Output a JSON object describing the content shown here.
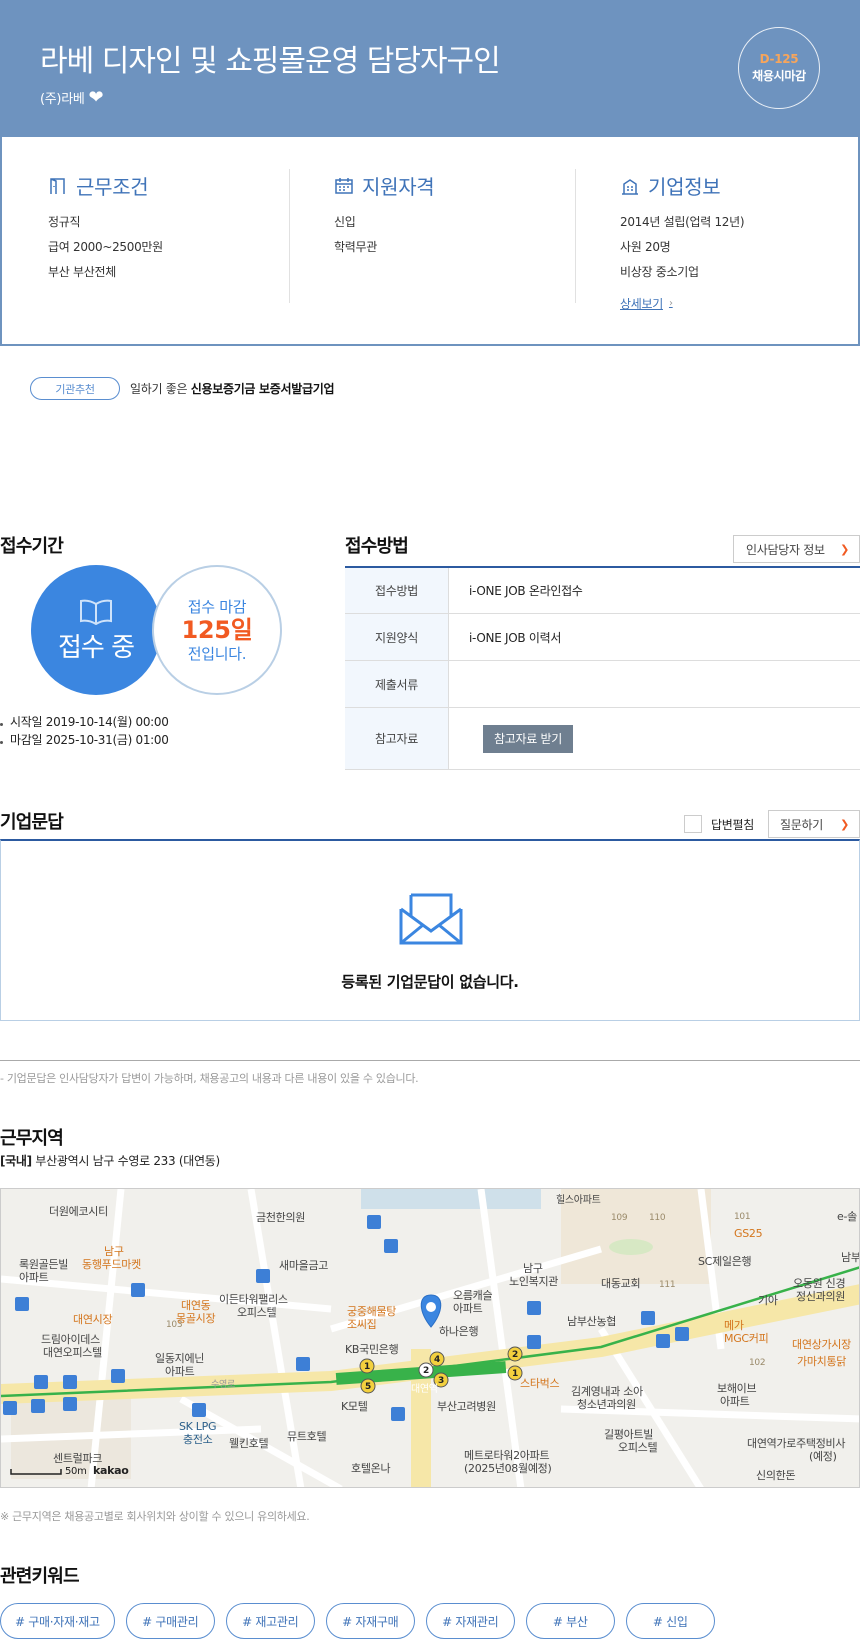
{
  "header": {
    "title": "라베 디자인 및 쇼핑몰운영 담당자구인",
    "company": "(주)라베",
    "dday": "D-125",
    "dday_label": "채용시마감"
  },
  "summary": {
    "work": {
      "title": "근무조건",
      "lines": [
        "정규직",
        "급여 2000~2500만원",
        "부산 부산전체"
      ]
    },
    "qual": {
      "title": "지원자격",
      "lines": [
        "신입",
        "학력무관"
      ]
    },
    "company": {
      "title": "기업정보",
      "lines": [
        "2014년 설립(업력 12년)",
        "사원 20명",
        "비상장 중소기업"
      ],
      "detail_link": "상세보기"
    }
  },
  "recommend": {
    "badge": "기관추천",
    "prefix": "일하기 좋은 ",
    "bold": "신용보증기금 보증서발급기업"
  },
  "period": {
    "title": "접수기간",
    "status": "접수 중",
    "remain_prefix": "접수 마감",
    "remain_days": "125일",
    "remain_suffix": "전입니다.",
    "start": "시작일 2019-10-14(월) 00:00",
    "end": "마감일 2025-10-31(금) 01:00"
  },
  "method": {
    "title": "접수방법",
    "hr_button": "인사담당자 정보",
    "rows": [
      {
        "key": "접수방법",
        "value": "i-ONE JOB 온라인접수"
      },
      {
        "key": "지원양식",
        "value": "i-ONE JOB 이력서"
      },
      {
        "key": "제출서류",
        "value": ""
      },
      {
        "key": "참고자료",
        "button": "참고자료 받기"
      }
    ]
  },
  "qa": {
    "title": "기업문답",
    "toggle_label": "답변펼침",
    "ask_button": "질문하기",
    "empty_text": "등록된 기업문답이 없습니다.",
    "note": "- 기업문답은 인사담당자가 답변이 가능하며, 채용공고의 내용과 다른 내용이 있을 수 있습니다."
  },
  "location": {
    "title": "근무지역",
    "region_tag": "[국내]",
    "address": "부산광역시 남구 수영로 233 (대연동)",
    "note": "※ 근무지역은 채용공고별로 회사위치와 상이할 수 있으니 유의하세요.",
    "map_labels": {
      "l1": "더원에코시티",
      "l2": "금천한의원",
      "l3": "힐스아파트",
      "l4": "남구",
      "l5": "동행푸드마켓",
      "l6": "록원골든빌",
      "l7": "아파트",
      "l8": "새마을금고",
      "l9": "남구",
      "l10": "노인복지관",
      "l11": "대동교회",
      "l12": "SC제일은행",
      "l13": "오동원 신경",
      "l14": "정신과의원",
      "l15": "대연시장",
      "l16": "대연동",
      "l17": "몽골시장",
      "l18": "이든타워팰리스",
      "l19": "오피스텔",
      "l20": "궁중해물탕",
      "l21": "조씨집",
      "l22": "오름캐슬",
      "l23": "아파트",
      "l24": "하나은행",
      "l25": "남부산농협",
      "l26": "메가",
      "l27": "MGC커피",
      "l28": "대연상가시장",
      "l29": "가마치통닭",
      "l30": "드림아이데스",
      "l31": "대연오피스텔",
      "l32": "일동지에닌",
      "l33": "아파트",
      "l34": "KB국민은행",
      "l35": "대연역",
      "l36": "스타벅스",
      "l37": "김계영내과 소아",
      "l38": "청소년과의원",
      "l39": "보해이브",
      "l40": "아파트",
      "l41": "수영로",
      "l42": "K모텔",
      "l43": "부산고려병원",
      "l44": "SK LPG",
      "l45": "충전소",
      "l46": "웰킨호텔",
      "l47": "뮤트호텔",
      "l48": "길평아트빌",
      "l49": "오피스텔",
      "l50": "대연역가로주택정비사",
      "l51": "(예정)",
      "l52": "센트럴파크",
      "l53": "호텔온나",
      "l54": "메트로타워2아파트",
      "l55": "(2025년08월예정)",
      "l56": "신의한돈",
      "l57": "GS25",
      "l58": "기아",
      "l59": "e-솔",
      "l60": "남부",
      "l61": "50m",
      "l62": "kakao",
      "l63": "109",
      "l64": "110",
      "l65": "101",
      "l66": "111",
      "l67": "102",
      "l68": "103",
      "l69": "1"
    }
  },
  "keywords": {
    "title": "관련키워드",
    "items": [
      "# 구매·자재·재고",
      "# 구매관리",
      "# 재고관리",
      "# 자재구매",
      "# 자재관리",
      "# 부산",
      "# 신입"
    ]
  },
  "colors": {
    "header_bg": "#6e93bf",
    "accent_blue": "#3b86e0",
    "orange": "#f15a22",
    "navy": "#2c5aa0"
  }
}
